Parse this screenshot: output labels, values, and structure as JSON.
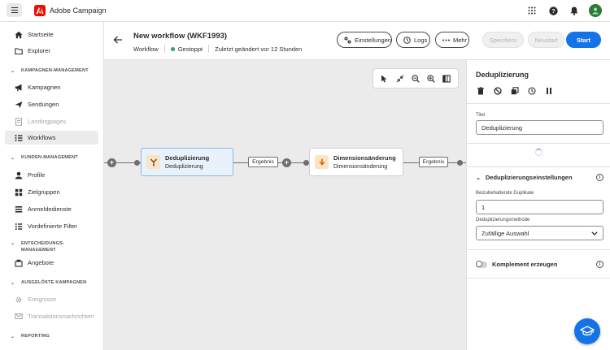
{
  "app": {
    "name": "Adobe Campaign"
  },
  "sidebar": {
    "items": [
      {
        "label": "Startseite",
        "icon": "home-icon"
      },
      {
        "label": "Explorer",
        "icon": "folder-icon"
      },
      {
        "label": "Kampagnen",
        "icon": "megaphone-icon"
      },
      {
        "label": "Sendungen",
        "icon": "send-icon"
      },
      {
        "label": "Landingpages",
        "icon": "page-icon"
      },
      {
        "label": "Workflows",
        "icon": "workflow-icon"
      },
      {
        "label": "Profile",
        "icon": "user-icon"
      },
      {
        "label": "Zielgruppen",
        "icon": "group-icon"
      },
      {
        "label": "Anmeldedienste",
        "icon": "subscription-icon"
      },
      {
        "label": "Vordefinierte Filter",
        "icon": "filter-icon"
      },
      {
        "label": "Angebote",
        "icon": "offer-icon"
      },
      {
        "label": "Ereignisse",
        "icon": "gear-icon"
      },
      {
        "label": "Transaktionsnachrichten",
        "icon": "message-icon"
      }
    ],
    "sections": {
      "campaign": "KAMPAGNEN-MANAGEMENT",
      "customer": "KUNDEN-MANAGEMENT",
      "decision": "ENTSCHEIDUNGS-",
      "decision2": "MANAGEMENT",
      "triggered": "AUSGELÖSTE KAMPAGNEN",
      "reporting": "REPORTING"
    }
  },
  "header": {
    "title": "New workflow (WKF1993)",
    "type": "Workflow",
    "status": "Gestoppt",
    "modified": "Zuletzt geändert vor 12 Stunden",
    "buttons": {
      "settings": "Einstellungen",
      "logs": "Logs",
      "more": "Mehr",
      "save": "Speichern",
      "restart": "Neustart",
      "start": "Start"
    }
  },
  "canvas": {
    "nodes": [
      {
        "title": "Deduplizierung",
        "subtitle": "Deduplizierung",
        "color": "#fbe3c4"
      },
      {
        "title": "Dimensionsänderung",
        "subtitle": "Dimensionsänderung",
        "color": "#fbe3c4"
      }
    ],
    "result_label": "Ergebnis"
  },
  "panel": {
    "title": "Deduplizierung",
    "title_label": "Titel",
    "title_value": "Deduplizierung",
    "section": "Deduplizierungseinstellungen",
    "keep_label": "Beizubehaltende Duplikate",
    "keep_value": "1",
    "method_label": "Deduplizierungsmethode",
    "method_value": "Zufällige Auswahl",
    "complement_label": "Komplement erzeugen"
  },
  "colors": {
    "accent": "#1473e6",
    "status": "#2d9d78"
  }
}
